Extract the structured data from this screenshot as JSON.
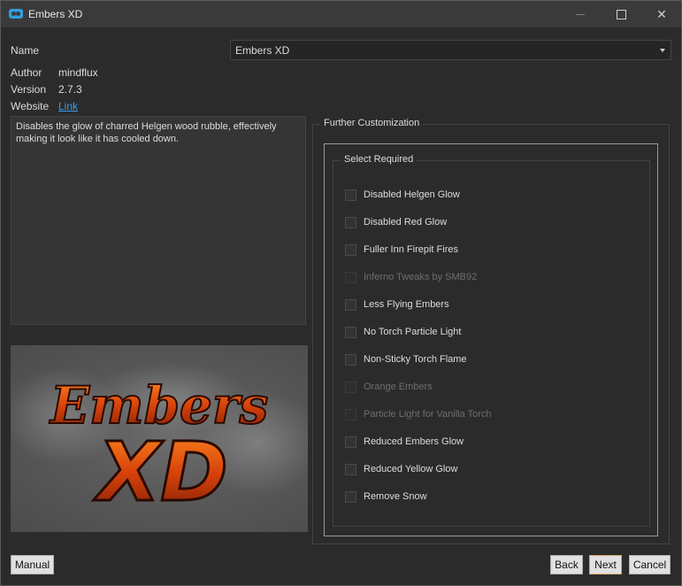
{
  "window": {
    "title": "Embers XD"
  },
  "info": {
    "name_label": "Name",
    "name_value": "Embers XD",
    "author_label": "Author",
    "author_value": "mindflux",
    "version_label": "Version",
    "version_value": "2.7.3",
    "website_label": "Website",
    "website_link": "Link",
    "description": "Disables the glow of charred Helgen wood rubble, effectively making it look like it has cooled down."
  },
  "image": {
    "line1": "Embers",
    "line2": "XD"
  },
  "customization": {
    "group_title": "Further Customization",
    "inner_title": "Select Required",
    "options": [
      {
        "label": "Disabled Helgen Glow",
        "enabled": true,
        "checked": false
      },
      {
        "label": "Disabled Red Glow",
        "enabled": true,
        "checked": false
      },
      {
        "label": "Fuller Inn Firepit Fires",
        "enabled": true,
        "checked": false
      },
      {
        "label": "Inferno Tweaks by SMB92",
        "enabled": false,
        "checked": false
      },
      {
        "label": "Less Flying Embers",
        "enabled": true,
        "checked": false
      },
      {
        "label": "No Torch Particle Light",
        "enabled": true,
        "checked": false
      },
      {
        "label": "Non-Sticky Torch Flame",
        "enabled": true,
        "checked": false
      },
      {
        "label": "Orange Embers",
        "enabled": false,
        "checked": false
      },
      {
        "label": "Particle Light for Vanilla Torch",
        "enabled": false,
        "checked": false
      },
      {
        "label": "Reduced Embers Glow",
        "enabled": true,
        "checked": false
      },
      {
        "label": "Reduced Yellow Glow",
        "enabled": true,
        "checked": false
      },
      {
        "label": "Remove Snow",
        "enabled": true,
        "checked": false
      }
    ]
  },
  "buttons": {
    "manual": "Manual",
    "back": "Back",
    "next": "Next",
    "cancel": "Cancel"
  },
  "colors": {
    "accent_link": "#3a9bf0",
    "background": "#2b2b2b",
    "primary_button_border": "#d9a36b"
  }
}
